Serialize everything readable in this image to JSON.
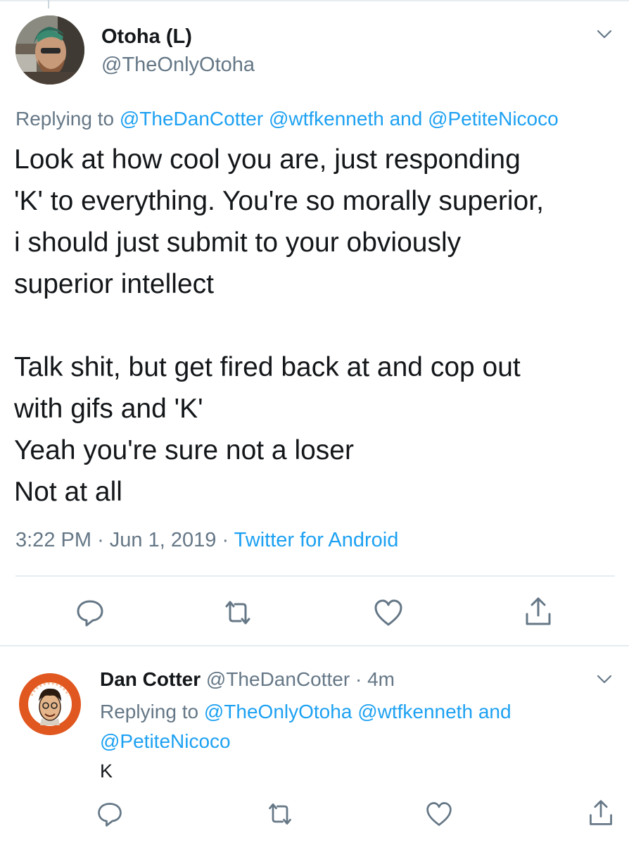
{
  "tweet": {
    "author_name": "Otoha (L)",
    "author_handle": "@TheOnlyOtoha",
    "replying_prefix": "Replying to",
    "reply_mentions": [
      "@TheDanCotter",
      "@wtfkenneth"
    ],
    "reply_and": "and",
    "reply_last_mention": "@PetiteNicoco",
    "paragraph_1": "Look at how cool you are, just responding\n'K' to everything. You're so morally superior,\ni should just submit to your obviously\nsuperior intellect",
    "paragraph_2": "Talk shit, but get fired back at and cop out\nwith gifs and 'K'\nYeah you're sure not a loser\nNot at all",
    "time": "3:22 PM",
    "separator": "·",
    "date": "Jun 1, 2019",
    "source": "Twitter for Android"
  },
  "reply": {
    "author_name": "Dan Cotter",
    "author_handle": "@TheDanCotter",
    "separator": "·",
    "age": "4m",
    "replying_prefix": "Replying to",
    "reply_mentions": [
      "@TheOnlyOtoha",
      "@wtfkenneth"
    ],
    "reply_and": "and",
    "reply_last_mention": "@PetiteNicoco",
    "text": "K",
    "avatar_badge_text": "Since 1987"
  },
  "icons": {
    "reply": "reply-icon",
    "retweet": "retweet-icon",
    "like": "heart-icon",
    "share": "share-icon",
    "more": "chevron-down-icon"
  },
  "colors": {
    "text": "#14171a",
    "secondary": "#657786",
    "link": "#1da1f2",
    "divider": "#e6ecf0"
  }
}
